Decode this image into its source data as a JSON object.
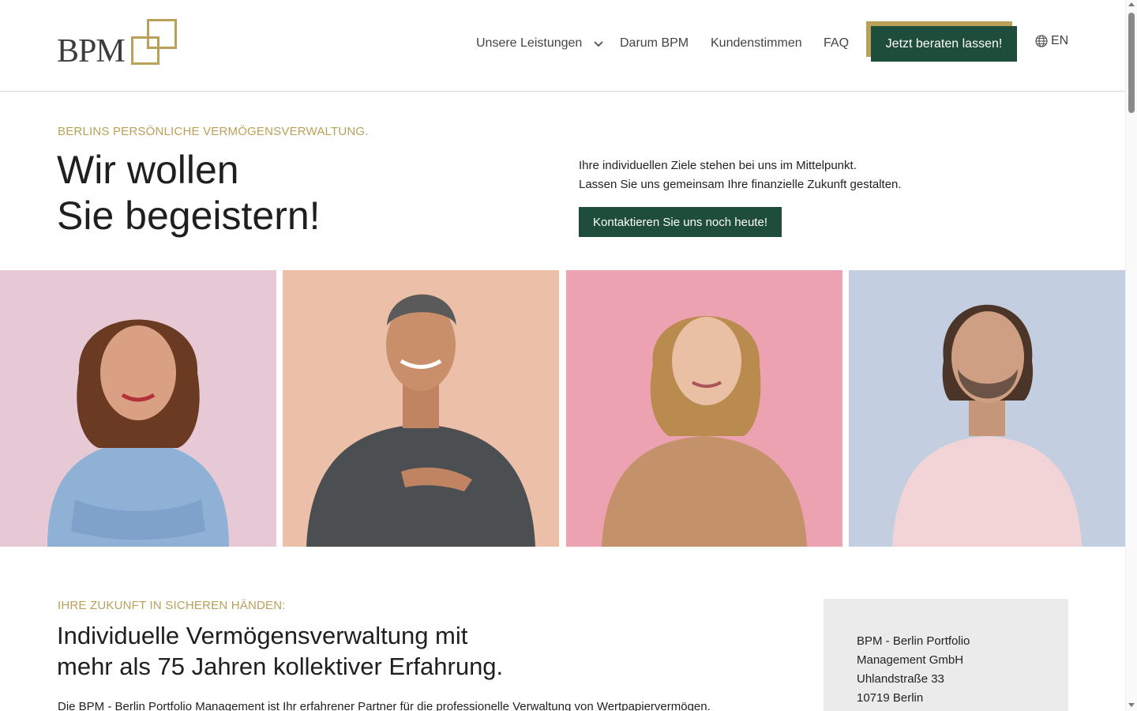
{
  "brand": {
    "logo_text": "BPM",
    "accent": "#b9a15a",
    "primary": "#1e4d3c"
  },
  "nav": {
    "leistungen": "Unsere Leistungen",
    "darum": "Darum BPM",
    "kunden": "Kundenstimmen",
    "faq": "FAQ",
    "cta": "Jetzt beraten lassen!",
    "lang": "EN"
  },
  "hero": {
    "eyebrow": "BERLINS PERSÖNLICHE VERMÖGENSVERWALTUNG.",
    "title_line1": "Wir wollen",
    "title_line2": "Sie begeistern!",
    "text_line1": "Ihre individuellen Ziele stehen bei uns im Mittelpunkt.",
    "text_line2": "Lassen Sie uns gemeinsam Ihre finanzielle Zukunft gestalten.",
    "button": "Kontaktieren Sie uns noch heute!"
  },
  "photos": [
    {
      "bg": "#e7c9d6"
    },
    {
      "bg": "#ecbfa9"
    },
    {
      "bg": "#eda2b1"
    },
    {
      "bg": "#c3cfe0"
    }
  ],
  "section": {
    "eyebrow": "IHRE ZUKUNFT IN SICHEREN HÄNDEN:",
    "title_line1": "Individuelle Vermögensverwaltung mit",
    "title_line2": "mehr als 75 Jahren kollektiver Erfahrung.",
    "text": "Die BPM - Berlin Portfolio Management ist Ihr erfahrener Partner für die professionelle Verwaltung von Wertpapiervermögen."
  },
  "address": {
    "line1": "BPM - Berlin Portfolio",
    "line2": "Management GmbH",
    "line3": "Uhlandstraße 33",
    "line4": "10719 Berlin"
  }
}
